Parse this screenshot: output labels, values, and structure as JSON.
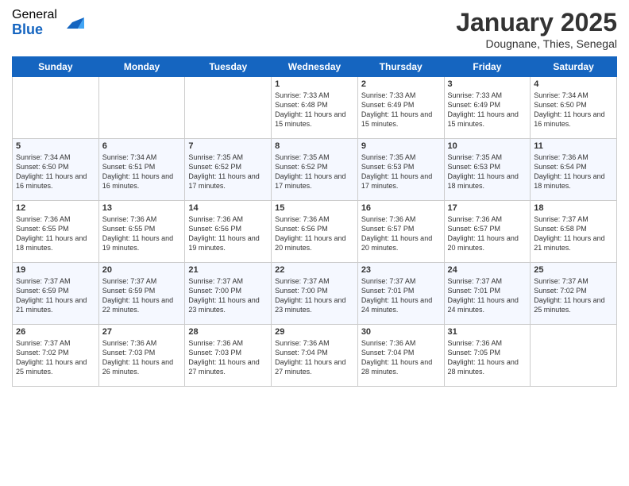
{
  "logo": {
    "general": "General",
    "blue": "Blue"
  },
  "header": {
    "title": "January 2025",
    "location": "Dougnane, Thies, Senegal"
  },
  "weekdays": [
    "Sunday",
    "Monday",
    "Tuesday",
    "Wednesday",
    "Thursday",
    "Friday",
    "Saturday"
  ],
  "weeks": [
    [
      {
        "day": "",
        "info": ""
      },
      {
        "day": "",
        "info": ""
      },
      {
        "day": "",
        "info": ""
      },
      {
        "day": "1",
        "info": "Sunrise: 7:33 AM\nSunset: 6:48 PM\nDaylight: 11 hours\nand 15 minutes."
      },
      {
        "day": "2",
        "info": "Sunrise: 7:33 AM\nSunset: 6:49 PM\nDaylight: 11 hours\nand 15 minutes."
      },
      {
        "day": "3",
        "info": "Sunrise: 7:33 AM\nSunset: 6:49 PM\nDaylight: 11 hours\nand 15 minutes."
      },
      {
        "day": "4",
        "info": "Sunrise: 7:34 AM\nSunset: 6:50 PM\nDaylight: 11 hours\nand 16 minutes."
      }
    ],
    [
      {
        "day": "5",
        "info": "Sunrise: 7:34 AM\nSunset: 6:50 PM\nDaylight: 11 hours\nand 16 minutes."
      },
      {
        "day": "6",
        "info": "Sunrise: 7:34 AM\nSunset: 6:51 PM\nDaylight: 11 hours\nand 16 minutes."
      },
      {
        "day": "7",
        "info": "Sunrise: 7:35 AM\nSunset: 6:52 PM\nDaylight: 11 hours\nand 17 minutes."
      },
      {
        "day": "8",
        "info": "Sunrise: 7:35 AM\nSunset: 6:52 PM\nDaylight: 11 hours\nand 17 minutes."
      },
      {
        "day": "9",
        "info": "Sunrise: 7:35 AM\nSunset: 6:53 PM\nDaylight: 11 hours\nand 17 minutes."
      },
      {
        "day": "10",
        "info": "Sunrise: 7:35 AM\nSunset: 6:53 PM\nDaylight: 11 hours\nand 18 minutes."
      },
      {
        "day": "11",
        "info": "Sunrise: 7:36 AM\nSunset: 6:54 PM\nDaylight: 11 hours\nand 18 minutes."
      }
    ],
    [
      {
        "day": "12",
        "info": "Sunrise: 7:36 AM\nSunset: 6:55 PM\nDaylight: 11 hours\nand 18 minutes."
      },
      {
        "day": "13",
        "info": "Sunrise: 7:36 AM\nSunset: 6:55 PM\nDaylight: 11 hours\nand 19 minutes."
      },
      {
        "day": "14",
        "info": "Sunrise: 7:36 AM\nSunset: 6:56 PM\nDaylight: 11 hours\nand 19 minutes."
      },
      {
        "day": "15",
        "info": "Sunrise: 7:36 AM\nSunset: 6:56 PM\nDaylight: 11 hours\nand 20 minutes."
      },
      {
        "day": "16",
        "info": "Sunrise: 7:36 AM\nSunset: 6:57 PM\nDaylight: 11 hours\nand 20 minutes."
      },
      {
        "day": "17",
        "info": "Sunrise: 7:36 AM\nSunset: 6:57 PM\nDaylight: 11 hours\nand 20 minutes."
      },
      {
        "day": "18",
        "info": "Sunrise: 7:37 AM\nSunset: 6:58 PM\nDaylight: 11 hours\nand 21 minutes."
      }
    ],
    [
      {
        "day": "19",
        "info": "Sunrise: 7:37 AM\nSunset: 6:59 PM\nDaylight: 11 hours\nand 21 minutes."
      },
      {
        "day": "20",
        "info": "Sunrise: 7:37 AM\nSunset: 6:59 PM\nDaylight: 11 hours\nand 22 minutes."
      },
      {
        "day": "21",
        "info": "Sunrise: 7:37 AM\nSunset: 7:00 PM\nDaylight: 11 hours\nand 23 minutes."
      },
      {
        "day": "22",
        "info": "Sunrise: 7:37 AM\nSunset: 7:00 PM\nDaylight: 11 hours\nand 23 minutes."
      },
      {
        "day": "23",
        "info": "Sunrise: 7:37 AM\nSunset: 7:01 PM\nDaylight: 11 hours\nand 24 minutes."
      },
      {
        "day": "24",
        "info": "Sunrise: 7:37 AM\nSunset: 7:01 PM\nDaylight: 11 hours\nand 24 minutes."
      },
      {
        "day": "25",
        "info": "Sunrise: 7:37 AM\nSunset: 7:02 PM\nDaylight: 11 hours\nand 25 minutes."
      }
    ],
    [
      {
        "day": "26",
        "info": "Sunrise: 7:37 AM\nSunset: 7:02 PM\nDaylight: 11 hours\nand 25 minutes."
      },
      {
        "day": "27",
        "info": "Sunrise: 7:36 AM\nSunset: 7:03 PM\nDaylight: 11 hours\nand 26 minutes."
      },
      {
        "day": "28",
        "info": "Sunrise: 7:36 AM\nSunset: 7:03 PM\nDaylight: 11 hours\nand 27 minutes."
      },
      {
        "day": "29",
        "info": "Sunrise: 7:36 AM\nSunset: 7:04 PM\nDaylight: 11 hours\nand 27 minutes."
      },
      {
        "day": "30",
        "info": "Sunrise: 7:36 AM\nSunset: 7:04 PM\nDaylight: 11 hours\nand 28 minutes."
      },
      {
        "day": "31",
        "info": "Sunrise: 7:36 AM\nSunset: 7:05 PM\nDaylight: 11 hours\nand 28 minutes."
      },
      {
        "day": "",
        "info": ""
      }
    ]
  ]
}
